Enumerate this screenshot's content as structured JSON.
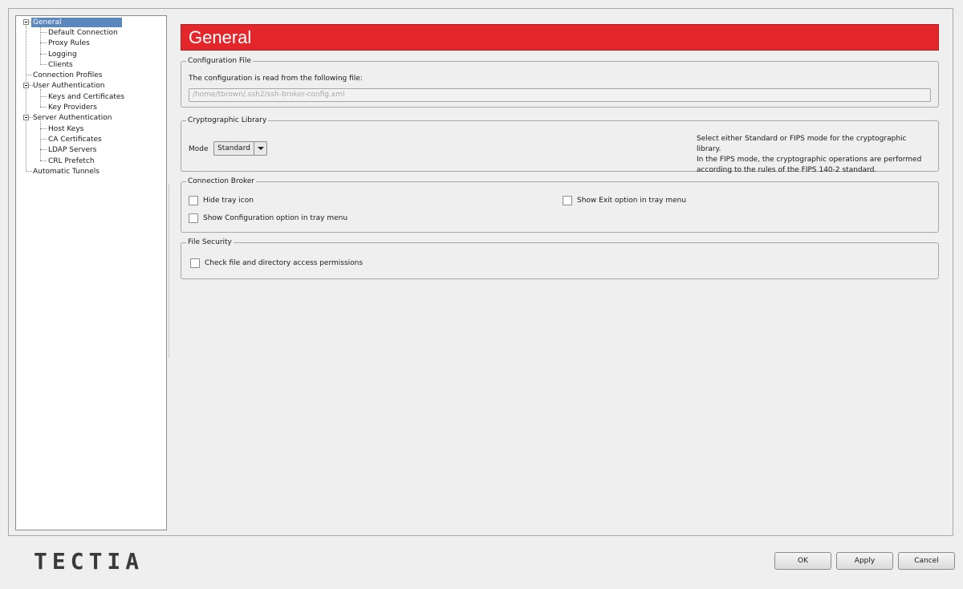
{
  "tree": {
    "items": [
      {
        "label": "General"
      },
      {
        "label": "Default Connection"
      },
      {
        "label": "Proxy Rules"
      },
      {
        "label": "Logging"
      },
      {
        "label": "Clients"
      },
      {
        "label": "Connection Profiles"
      },
      {
        "label": "User Authentication"
      },
      {
        "label": "Keys and Certificates"
      },
      {
        "label": "Key Providers"
      },
      {
        "label": "Server Authentication"
      },
      {
        "label": "Host Keys"
      },
      {
        "label": "CA Certificates"
      },
      {
        "label": "LDAP Servers"
      },
      {
        "label": "CRL Prefetch"
      },
      {
        "label": "Automatic Tunnels"
      }
    ]
  },
  "main": {
    "title": "General",
    "config_file": {
      "title": "Configuration File",
      "desc": "The configuration is read from the following file:",
      "path": "/home/tbrown/.ssh2/ssh-broker-config.xml"
    },
    "crypto": {
      "title": "Cryptographic Library",
      "mode_label": "Mode",
      "mode_value": "Standard",
      "note_line1": "Select either Standard or FIPS mode for the cryptographic library.",
      "note_line2": "In the FIPS mode, the cryptographic operations are performed",
      "note_line3": "according to the rules of the FIPS 140-2 standard."
    },
    "broker": {
      "title": "Connection Broker",
      "hide_tray": "Hide tray icon",
      "show_exit": "Show Exit option in tray menu",
      "show_config": "Show Configuration option in tray menu"
    },
    "file_security": {
      "title": "File Security",
      "check_perms": "Check file and directory access permissions"
    }
  },
  "footer": {
    "logo": "TECTIA",
    "ok": "OK",
    "apply": "Apply",
    "cancel": "Cancel"
  },
  "colors": {
    "banner": "#e3262a",
    "selection": "#5b87bd"
  }
}
